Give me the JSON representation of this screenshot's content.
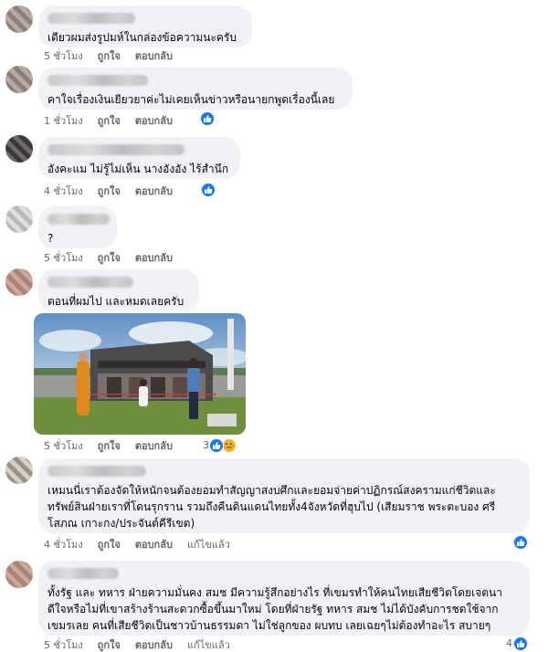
{
  "comments": [
    {
      "text": "เดียวผมส่งรูปมห์ในกล่องข้อความนะครับ",
      "time": "5 ชั่วโมง",
      "like": "ถูกใจ",
      "reply": "ตอบกลับ"
    },
    {
      "text": "คาใจเรื่องเงินเยียวยาค่ะไม่เคยเห็นข่าวหรือนายกพูดเรื่องนี้เลย",
      "time": "1 ชั่วโมง",
      "like": "ถูกใจ",
      "reply": "ตอบกลับ"
    },
    {
      "text": "อังคะแม ไม่รู้ไม่เห็น นางอังอัง ไร้สำนึก",
      "time": "4 ชั่วโมง",
      "like": "ถูกใจ",
      "reply": "ตอบกลับ"
    },
    {
      "text": "?",
      "time": "5 ชั่วโมง",
      "like": "ถูกใจ",
      "reply": "ตอบกลับ"
    },
    {
      "text": "ตอนที่ผมไป และหมดเลยครับ",
      "time": "5 ชั่วโมง",
      "like": "ถูกใจ",
      "reply": "ตอบกลับ",
      "reaction_count": "3"
    },
    {
      "text": "เหมนนี่เราต้องจัดให้หนักจนต้องยอมทำสัญญาสงบศึกและยอมจ่ายค่าปฏิกรณ์สงครามแก่ชีวิตและ\nทรัพย์สินฝ่ายเราที่โดนรุกราน รวมถึงคืนดินแดนไทยทั้ง4จังหวัดที่ฮุบไป (เสียมราช พระตะบอง ศรี\nโสภณ เกาะกง/ประจันต์คีรีเขต)",
      "time": "4 ชั่วโมง",
      "like": "ถูกใจ",
      "reply": "ตอบกลับ",
      "edited": "แก้ไขแล้ว"
    },
    {
      "text": "ทั้งรัฐ และ ทหาร ฝ่ายความมั่นคง สมช มีความรู้สึกอย่างไร ที่เขมรทำให้คนไทยเสียชีวิตโดยเจตนา\nดีใจหรือไม่ที่เขาสร้างร้านสะดวกซื้อขึ้นมาใหม่ โดยที่ฝ่ายรัฐ ทหาร สมช ไม่ได้บังคับการชดใช้จาก\nเขมรเลย คนที่เสียชีวิตเป็นชาวบ้านธรรมดา ไม่ใช่ลูกของ ผบทบ เลยเฉยๆไม่ต้องทำอะไร สบายๆ",
      "time": "5 ชั่วโมง",
      "like": "ถูกใจ",
      "reply": "ตอบกลับ",
      "edited": "แก้ไขแล้ว",
      "reaction_count": "4"
    }
  ],
  "colors": {
    "bubble": "#f0f2f5",
    "meta_text": "#65676b",
    "like_blue": "#1877f2"
  }
}
